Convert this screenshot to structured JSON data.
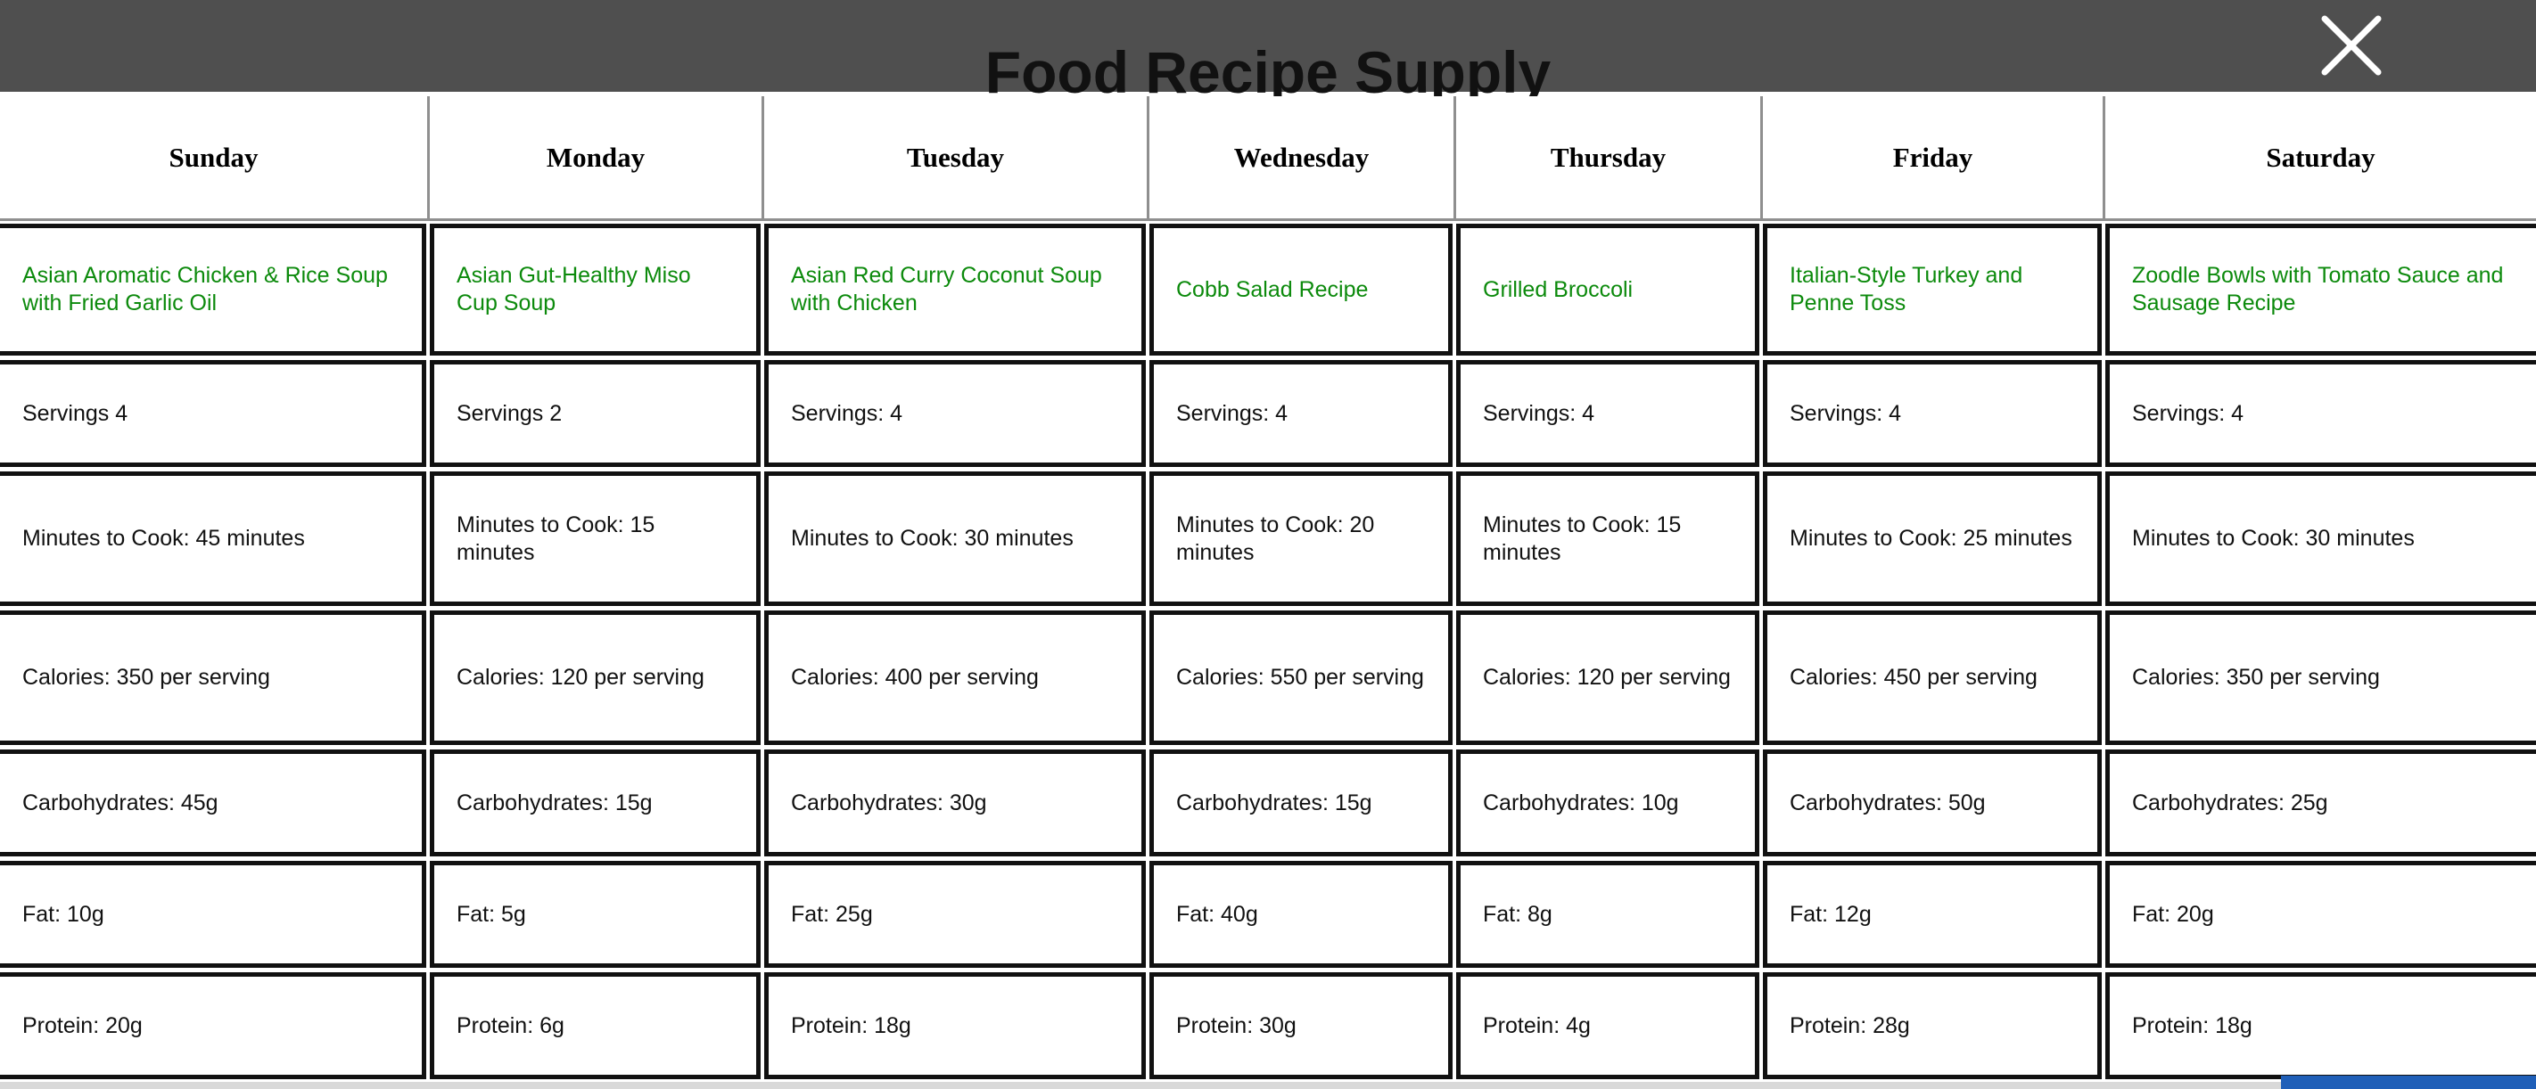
{
  "app": {
    "title": "Food Recipe Supply"
  },
  "modal": {
    "close_icon": "close-icon"
  },
  "days": [
    "Sunday",
    "Monday",
    "Tuesday",
    "Wednesday",
    "Thursday",
    "Friday",
    "Saturday"
  ],
  "recipes": [
    {
      "name": "Asian Aromatic Chicken & Rice Soup with Fried Garlic Oil",
      "servings": "Servings 4",
      "minutes": "Minutes to Cook: 45 minutes",
      "calories": "Calories: 350 per serving",
      "carbs": "Carbohydrates: 45g",
      "fat": "Fat: 10g",
      "protein": "Protein: 20g"
    },
    {
      "name": "Asian Gut-Healthy Miso Cup Soup",
      "servings": "Servings 2",
      "minutes": "Minutes to Cook: 15 minutes",
      "calories": "Calories: 120 per serving",
      "carbs": "Carbohydrates: 15g",
      "fat": "Fat: 5g",
      "protein": "Protein: 6g"
    },
    {
      "name": "Asian Red Curry Coconut Soup with Chicken",
      "servings": "Servings: 4",
      "minutes": "Minutes to Cook: 30 minutes",
      "calories": "Calories: 400 per serving",
      "carbs": "Carbohydrates: 30g",
      "fat": "Fat: 25g",
      "protein": "Protein: 18g"
    },
    {
      "name": "Cobb Salad Recipe",
      "servings": "Servings: 4",
      "minutes": "Minutes to Cook: 20 minutes",
      "calories": "Calories: 550 per serving",
      "carbs": "Carbohydrates: 15g",
      "fat": "Fat: 40g",
      "protein": "Protein: 30g"
    },
    {
      "name": "Grilled Broccoli",
      "servings": "Servings: 4",
      "minutes": "Minutes to Cook: 15 minutes",
      "calories": "Calories: 120 per serving",
      "carbs": "Carbohydrates: 10g",
      "fat": "Fat: 8g",
      "protein": "Protein: 4g"
    },
    {
      "name": "Italian-Style Turkey and Penne Toss",
      "servings": "Servings: 4",
      "minutes": "Minutes to Cook: 25 minutes",
      "calories": "Calories: 450 per serving",
      "carbs": "Carbohydrates: 50g",
      "fat": "Fat: 12g",
      "protein": "Protein: 28g"
    },
    {
      "name": "Zoodle Bowls with Tomato Sauce and Sausage Recipe",
      "servings": "Servings: 4",
      "minutes": "Minutes to Cook: 30 minutes",
      "calories": "Calories: 350 per serving",
      "carbs": "Carbohydrates: 25g",
      "fat": "Fat: 20g",
      "protein": "Protein: 18g"
    }
  ],
  "colors": {
    "header_bg": "#4f4f4f",
    "recipe_link": "#0c8a0c",
    "cell_border": "#111111"
  }
}
